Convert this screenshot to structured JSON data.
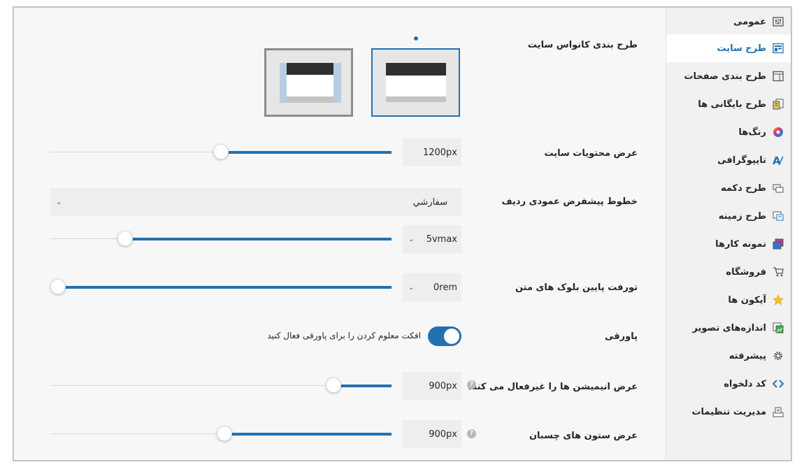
{
  "sidebar": {
    "items": [
      {
        "label": "عمومی",
        "icon": "sliders-icon",
        "active": false
      },
      {
        "label": "طرح سایت",
        "icon": "site-layout-icon",
        "active": true
      },
      {
        "label": "طرح بندی صفحات",
        "icon": "page-layout-icon",
        "active": false
      },
      {
        "label": "طرح بایگانی ها",
        "icon": "archive-layout-icon",
        "active": false
      },
      {
        "label": "رنگ‌ها",
        "icon": "color-wheel-icon",
        "active": false
      },
      {
        "label": "تایپوگرافی",
        "icon": "typography-icon",
        "active": false
      },
      {
        "label": "طرح دکمه",
        "icon": "button-style-icon",
        "active": false
      },
      {
        "label": "طرح زمینه",
        "icon": "background-icon",
        "active": false
      },
      {
        "label": "نمونه کارها",
        "icon": "portfolio-icon",
        "active": false
      },
      {
        "label": "فروشگاه",
        "icon": "cart-icon",
        "active": false
      },
      {
        "label": "آیکون ها",
        "icon": "star-icon",
        "active": false
      },
      {
        "label": "اندازه‌های تصویر",
        "icon": "image-sizes-icon",
        "active": false
      },
      {
        "label": "پیشرفته",
        "icon": "gear-icon",
        "active": false
      },
      {
        "label": "کد دلخواه",
        "icon": "code-icon",
        "active": false
      },
      {
        "label": "مدیریت تنظیمات",
        "icon": "import-export-icon",
        "active": false
      }
    ]
  },
  "settings": {
    "canvas_layout": {
      "label": "طرح بندی کانواس سایت",
      "options": [
        "full-width",
        "boxed"
      ],
      "selected": "full-width"
    },
    "content_width": {
      "label": "عرض محتویات سایت",
      "value": "1200px",
      "slider": 0.5
    },
    "row_padding": {
      "label": "خطوط پیشفرض عمودی ردیف",
      "select_value": "سفارشي",
      "value": "5vmax",
      "slider": 0.78
    },
    "text_block_margin": {
      "label": "تورفت پایین بلوک های متن",
      "value": "0rem",
      "slider": 1.0
    },
    "footnotes": {
      "label": "پاورقی",
      "toggle_text": "افکت معلوم کردن را برای پاورقی فعال کنید",
      "enabled": true
    },
    "animation_width": {
      "label": "عرض انیمیشن ها را غیرفعال می کنند",
      "value": "900px",
      "slider": 0.17
    },
    "sticky_width": {
      "label": "عرض ستون های چسبان",
      "value": "900px",
      "slider": 0.49
    }
  },
  "colors": {
    "accent": "#2271b1",
    "toggle_on": "#2271b1",
    "track": "#d6d6d6"
  }
}
